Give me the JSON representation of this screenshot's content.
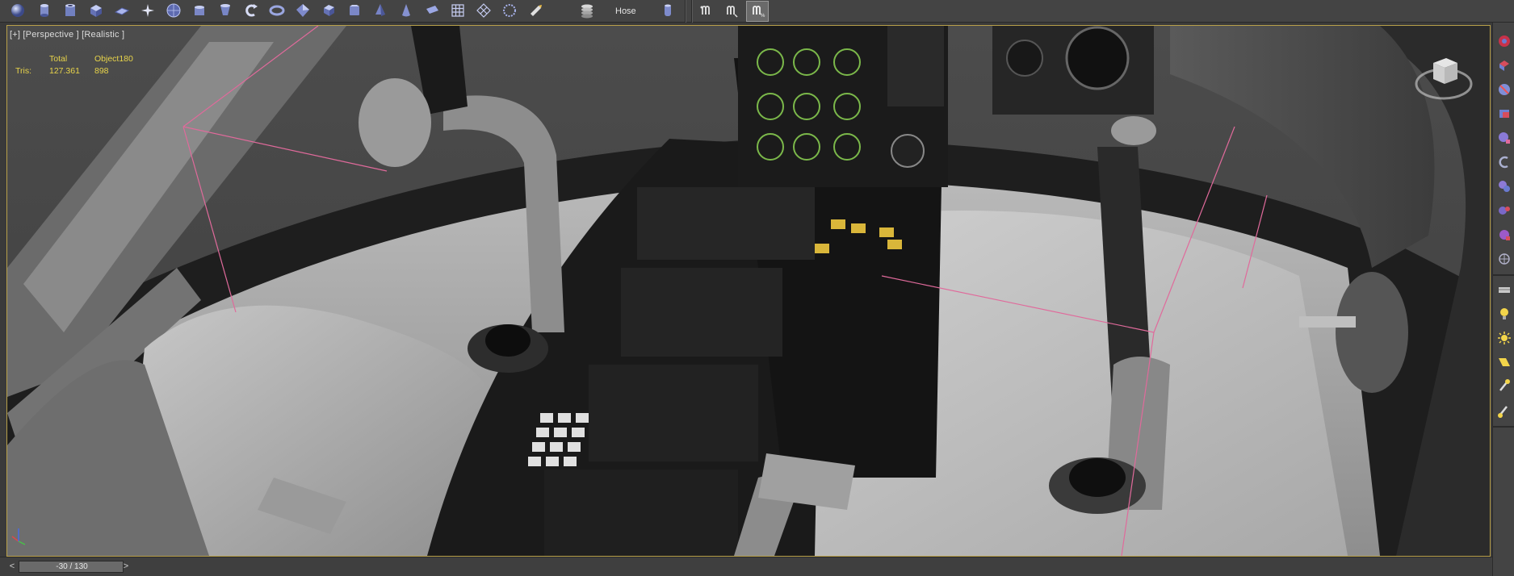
{
  "toolbar": {
    "object_name_label": "Hose",
    "icons": [
      "sphere-icon",
      "cylinder-icon",
      "tube-icon",
      "box-icon",
      "plane-icon",
      "star-icon",
      "geosphere-icon",
      "pyramid-icon",
      "cone-icon",
      "spring-icon",
      "torus-icon",
      "hedra-icon",
      "chamfer-box-icon",
      "oil-tank-icon",
      "gengon-icon",
      "capsule-icon",
      "prism-icon",
      "grid-icon",
      "torus-knot-icon",
      "spindle-icon",
      "hose-icon"
    ],
    "right_icons": [
      "snap-toggle-icon",
      "snap-options-icon",
      "snap-grid-icon"
    ]
  },
  "viewport": {
    "label_plus": "[+]",
    "label_view": "[Perspective ]",
    "label_shading": "[Realistic ]",
    "stats": {
      "header_total": "Total",
      "header_object": "Object180",
      "row_label": "Tris:",
      "total_value": "127.361",
      "object_value": "898"
    },
    "border_color": "#b8a04a",
    "stats_color": "#e8d44a"
  },
  "command_panel": {
    "icons": [
      "create-geometry-icon",
      "create-shapes-icon",
      "create-lights-icon",
      "create-cameras-icon",
      "create-helpers-icon",
      "create-spacewarps-icon",
      "create-systems-icon",
      "extended-primitives-icon",
      "compound-objects-icon",
      "particles-icon",
      "patch-grids-icon",
      "nurbs-icon",
      "light-omni-icon",
      "light-sun-icon",
      "light-spot-icon",
      "light-target-icon",
      "light-free-icon"
    ]
  },
  "timeline": {
    "range_text": "-30 / 130",
    "prev_arrow": "<",
    "next_arrow": ">"
  }
}
